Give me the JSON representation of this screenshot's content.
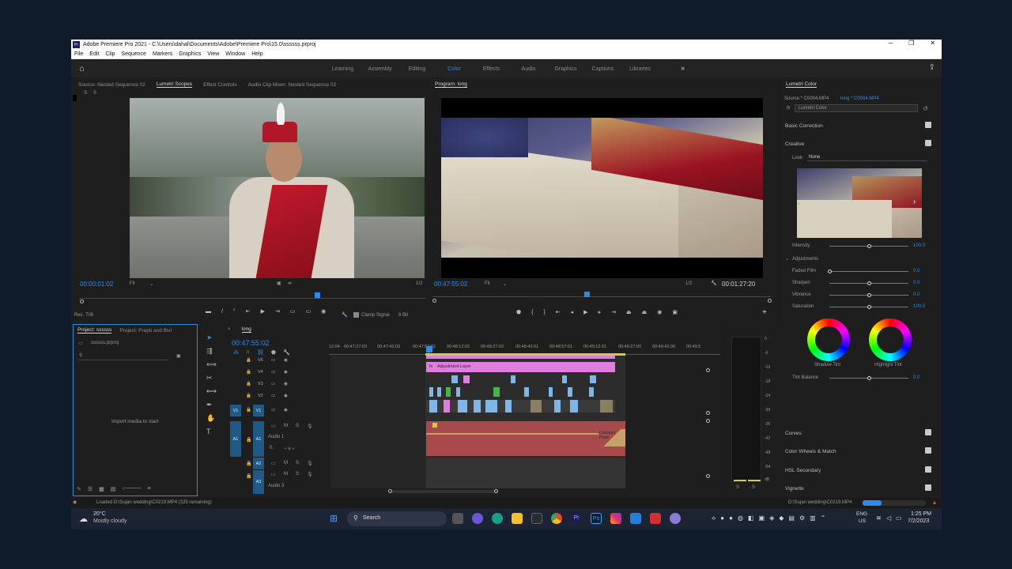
{
  "window": {
    "title": "Adobe Premiere Pro 2021 - C:\\Users\\dahal\\Documents\\Adobe\\Premiere Pro\\15.0\\ssssss.prproj",
    "menu": [
      "File",
      "Edit",
      "Clip",
      "Sequence",
      "Markers",
      "Graphics",
      "View",
      "Window",
      "Help"
    ]
  },
  "workspaces": {
    "tabs": [
      "Learning",
      "Assembly",
      "Editing",
      "Color",
      "Effects",
      "Audio",
      "Graphics",
      "Captions",
      "Libraries"
    ],
    "active": "Color",
    "more": "»"
  },
  "source_panel": {
    "tabs": [
      "Source: Nested Sequence 02",
      "Lumetri Scopes",
      "Effect Controls",
      "Audio Clip Mixer: Nested Sequence 02"
    ],
    "active_tab": "Lumetri Scopes",
    "timecode": "00:00:01:02",
    "fit": "Fit",
    "ratio": "1/2",
    "rec": "Rec. 709",
    "clamp_signal": "Clamp Signal",
    "bit_depth": "8 Bit",
    "s_labels": [
      "S",
      "S"
    ]
  },
  "program_panel": {
    "title": "Program: long",
    "timecode": "00:47:55:02",
    "fit": "Fit",
    "ratio": "1/2",
    "duration": "00:01:27:20"
  },
  "lumetri": {
    "title": "Lumetri Color",
    "source": "Source * C0004.MP4",
    "target": "long * C0004.MP4",
    "effect": "Lumetri Color",
    "fx": "fx",
    "basic_correction": "Basic Correction",
    "creative": "Creative",
    "look_label": "Look",
    "look_value": "None",
    "intensity_label": "Intensity",
    "intensity_value": "100.0",
    "adjustments": "Adjustments",
    "sliders": [
      {
        "label": "Faded Film",
        "value": "0.0"
      },
      {
        "label": "Sharpen",
        "value": "0.0"
      },
      {
        "label": "Vibrance",
        "value": "0.0"
      },
      {
        "label": "Saturation",
        "value": "100.0"
      }
    ],
    "shadow_tint": "Shadow Tint",
    "highlight_tint": "Highlight Tint",
    "tint_balance_label": "Tint Balance",
    "tint_balance_value": "0.0",
    "sections": [
      "Curves",
      "Color Wheels & Match",
      "HSL Secondary",
      "Vignette"
    ]
  },
  "project_panel": {
    "tabs": [
      "Project: ssssss",
      "Project: Prepti and Bivi"
    ],
    "file": "ssssss.prproj",
    "empty_text": "Import media to start"
  },
  "timeline": {
    "sequence": "long",
    "timecode": "00:47:55:02",
    "ruler": [
      "12:04",
      "00:47:27:03",
      "00:47:42:03",
      "00:47:57:02",
      "00:48:12:02",
      "00:48:27:02",
      "00:48:42:01",
      "00:48:57:01",
      "00:49:12:01",
      "00:49:27:00",
      "00:49:42:00",
      "00:49:5"
    ],
    "video_tracks": [
      "V5",
      "V4",
      "V3",
      "V2",
      "V1"
    ],
    "audio_tracks": [
      "A1",
      "A2",
      "A3"
    ],
    "audio1_name": "Audio 1",
    "audio3_name": "Audio 3",
    "adjustment_layer": "Adjustment Layer",
    "constant_power": "Constant Powe",
    "fx_label": "fx",
    "track_buttons": [
      "M",
      "S"
    ],
    "v1_chip": "V1",
    "a1_chip": "A1",
    "audio1_volume": "0.",
    "meter_scale": [
      "0",
      "-6",
      "-12",
      "-18",
      "-24",
      "-30",
      "-36",
      "-42",
      "-48",
      "-54",
      "dB"
    ],
    "meter_s": [
      "S",
      "S"
    ]
  },
  "status": {
    "message": "Loaded D:\\Sujan wedding\\C0219.MP4 (325 remaining)",
    "file": "D:\\Sujan wedding\\C0219.MP4",
    "progress": 0.3
  },
  "taskbar": {
    "temperature": "20°C",
    "weather": "Mostly cloudy",
    "search": "Search",
    "lang": "ENG",
    "region": "US",
    "time": "1:25 PM",
    "date": "7/2/2023",
    "pr_icon": "Pr",
    "ps_icon": "Ps"
  },
  "colors": {
    "accent": "#2d8ceb",
    "adjustment": "#e07ee0",
    "video_clip": "#7fb6e8",
    "audio_clip": "#a8494b",
    "green_clip": "#45b54a",
    "track_chip": "#1f5a86"
  }
}
